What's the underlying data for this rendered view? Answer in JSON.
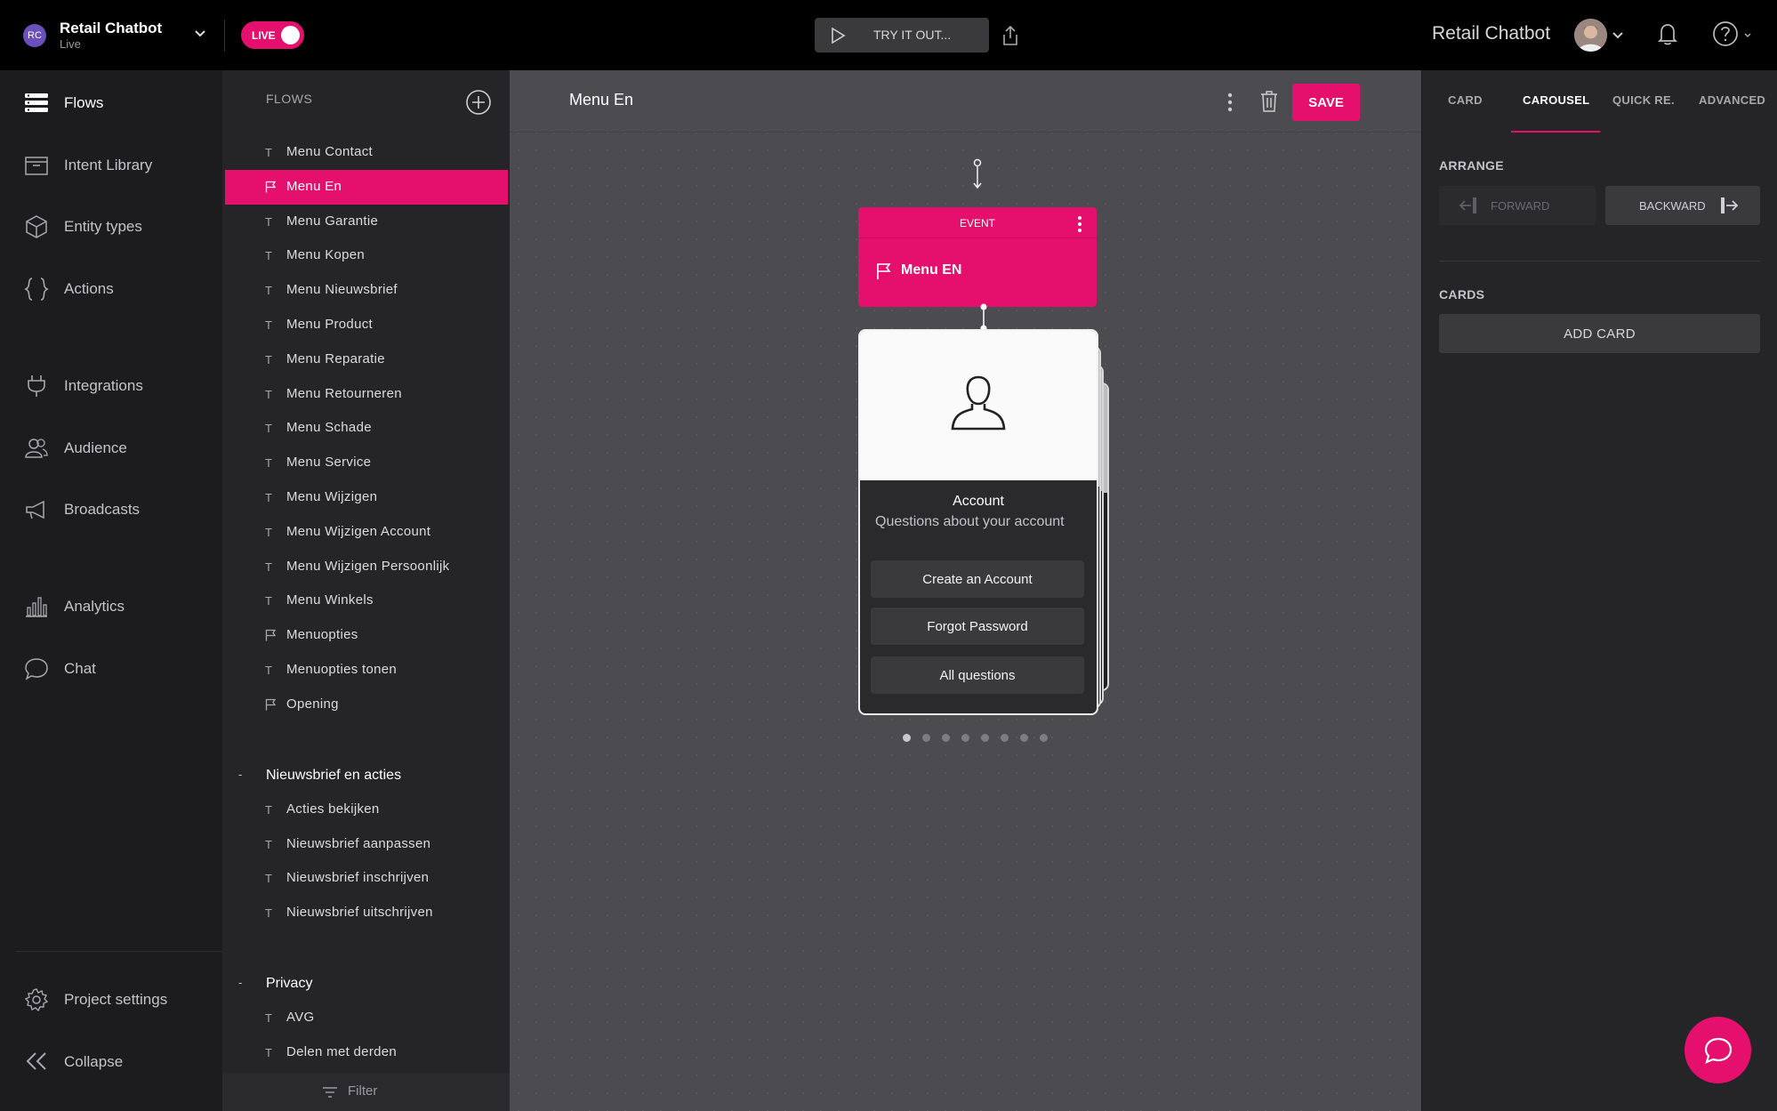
{
  "topbar": {
    "project_initials": "RC",
    "project_name": "Retail Chatbot",
    "project_status": "Live",
    "live_label": "LIVE",
    "try_label": "TRY IT OUT...",
    "bot_name": "Retail Chatbot"
  },
  "nav": {
    "items": [
      {
        "label": "Flows",
        "icon": "flows-icon"
      },
      {
        "label": "Intent Library",
        "icon": "inbox-icon"
      },
      {
        "label": "Entity types",
        "icon": "cube-icon"
      },
      {
        "label": "Actions",
        "icon": "braces-icon"
      },
      {
        "label": "Integrations",
        "icon": "plug-icon"
      },
      {
        "label": "Audience",
        "icon": "people-icon"
      },
      {
        "label": "Broadcasts",
        "icon": "megaphone-icon"
      },
      {
        "label": "Analytics",
        "icon": "bar-chart-icon"
      },
      {
        "label": "Chat",
        "icon": "chat-bubble-icon"
      }
    ],
    "settings_label": "Project settings",
    "collapse_label": "Collapse"
  },
  "flows": {
    "header": "FLOWS",
    "items": [
      {
        "label": "Menu Contact",
        "icon": "T"
      },
      {
        "label": "Menu En",
        "icon": "flag"
      },
      {
        "label": "Menu Garantie",
        "icon": "T"
      },
      {
        "label": "Menu Kopen",
        "icon": "T"
      },
      {
        "label": "Menu Nieuwsbrief",
        "icon": "T"
      },
      {
        "label": "Menu Product",
        "icon": "T"
      },
      {
        "label": "Menu Reparatie",
        "icon": "T"
      },
      {
        "label": "Menu Retourneren",
        "icon": "T"
      },
      {
        "label": "Menu Schade",
        "icon": "T"
      },
      {
        "label": "Menu Service",
        "icon": "T"
      },
      {
        "label": "Menu Wijzigen",
        "icon": "T"
      },
      {
        "label": "Menu Wijzigen Account",
        "icon": "T"
      },
      {
        "label": "Menu Wijzigen Persoonlijk",
        "icon": "T"
      },
      {
        "label": "Menu Winkels",
        "icon": "T"
      },
      {
        "label": "Menuopties",
        "icon": "flag"
      },
      {
        "label": "Menuopties tonen",
        "icon": "T"
      },
      {
        "label": "Opening",
        "icon": "flag"
      }
    ],
    "group1": {
      "minus": "-",
      "label": "Nieuwsbrief en acties",
      "items": [
        {
          "label": "Acties bekijken",
          "icon": "T"
        },
        {
          "label": "Nieuwsbrief aanpassen",
          "icon": "T"
        },
        {
          "label": "Nieuwsbrief inschrijven",
          "icon": "T"
        },
        {
          "label": "Nieuwsbrief uitschrijven",
          "icon": "T"
        }
      ]
    },
    "group2": {
      "minus": "-",
      "label": "Privacy",
      "items": [
        {
          "label": "AVG",
          "icon": "T"
        },
        {
          "label": "Delen met derden",
          "icon": "T"
        }
      ]
    },
    "filter_label": "Filter"
  },
  "canvas": {
    "title": "Menu En",
    "save_label": "SAVE",
    "event": {
      "type": "EVENT",
      "name": "Menu EN"
    },
    "card": {
      "title": "Account",
      "subtitle": "Questions about your account",
      "buttons": [
        "Create an Account",
        "Forgot Password",
        "All questions"
      ]
    },
    "pager": {
      "pages": 8,
      "active": 1
    }
  },
  "rightpanel": {
    "tabs": [
      "CARD",
      "CAROUSEL",
      "QUICK RE.",
      "ADVANCED"
    ],
    "active_tab": "CAROUSEL",
    "arrange_label": "ARRANGE",
    "forward_label": "FORWARD",
    "backward_label": "BACKWARD",
    "cards_label": "CARDS",
    "add_card_label": "ADD CARD"
  },
  "colors": {
    "accent": "#e5106e",
    "topbar": "#000000",
    "sidebar": "#1c1c1e",
    "panel": "#252527",
    "canvas": "#4b4b50"
  }
}
